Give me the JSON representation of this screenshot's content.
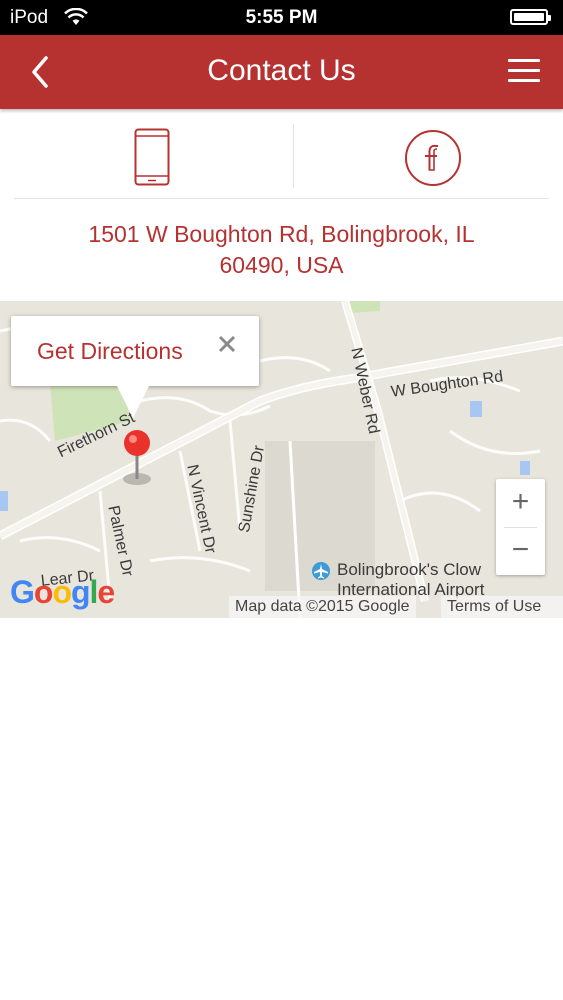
{
  "status_bar": {
    "carrier": "iPod",
    "time": "5:55 PM"
  },
  "nav": {
    "title": "Contact Us"
  },
  "contact": {
    "address_line1": "1501 W Boughton Rd, Bolingbrook, IL",
    "address_line2": "60490, USA"
  },
  "map": {
    "popup_label": "Get Directions",
    "roads": {
      "boughton": "W Boughton Rd",
      "weber": "N Weber Rd",
      "firethorn": "Firethorn St",
      "sunshine": "Sunshine Dr",
      "vincent": "N Vincent Dr",
      "palmer": "Palmer Dr",
      "lear": "Lear Dr"
    },
    "airport_line1": "Bolingbrook's Clow",
    "airport_line2": "International Airport",
    "zoom_in": "+",
    "zoom_out": "−",
    "attribution": "Map data ©2015 Google",
    "terms": "Terms of Use"
  },
  "colors": {
    "brand": "#b53231",
    "map_bg": "#e8e5dc"
  }
}
